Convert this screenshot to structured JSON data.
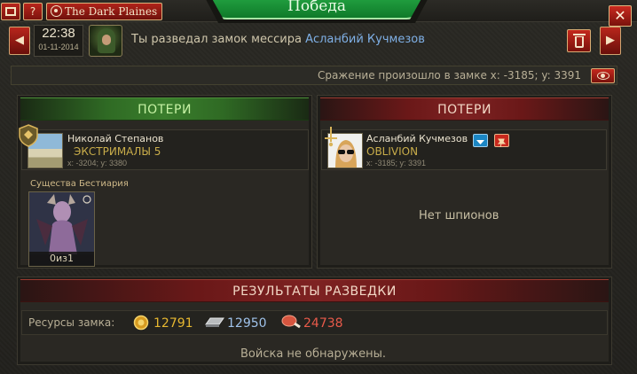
{
  "topbar": {
    "home_icon": "home-icon",
    "help_label": "?",
    "realm_name": "The Dark Plaines",
    "title": "Победа",
    "close_label": "✕"
  },
  "header": {
    "prev_label": "◀",
    "next_label": "▶",
    "time": "22:38",
    "date": "01-11-2014",
    "message_prefix": "Ты разведал замок мессира",
    "message_target": "Асланбий Кучмезов"
  },
  "battle_location": {
    "text": "Сражение произошло в замке x: -3185; y: 3391"
  },
  "left_panel": {
    "title": "ПОТЕРИ",
    "player_name": "Николай Степанов",
    "clan": "ЭКСТРИМАЛЫ 5",
    "coords": "x: -3204; y: 3380",
    "bestiary_label": "Существа Бестиария",
    "creature_count": "0из1"
  },
  "right_panel": {
    "title": "ПОТЕРИ",
    "player_name": "Асланбий Кучмезов",
    "clan": "OBLIVION",
    "coords": "x: -3185; y: 3391",
    "empty_text": "Нет шпионов"
  },
  "results": {
    "title": "РЕЗУЛЬТАТЫ РАЗВЕДКИ",
    "resources_label": "Ресурсы замка:",
    "gold": "12791",
    "iron": "12950",
    "food": "24738",
    "no_troops": "Войска не обнаружены.",
    "colors": {
      "gold": "#e6b730",
      "iron": "#9fc2ea",
      "food": "#e85a4a"
    }
  }
}
